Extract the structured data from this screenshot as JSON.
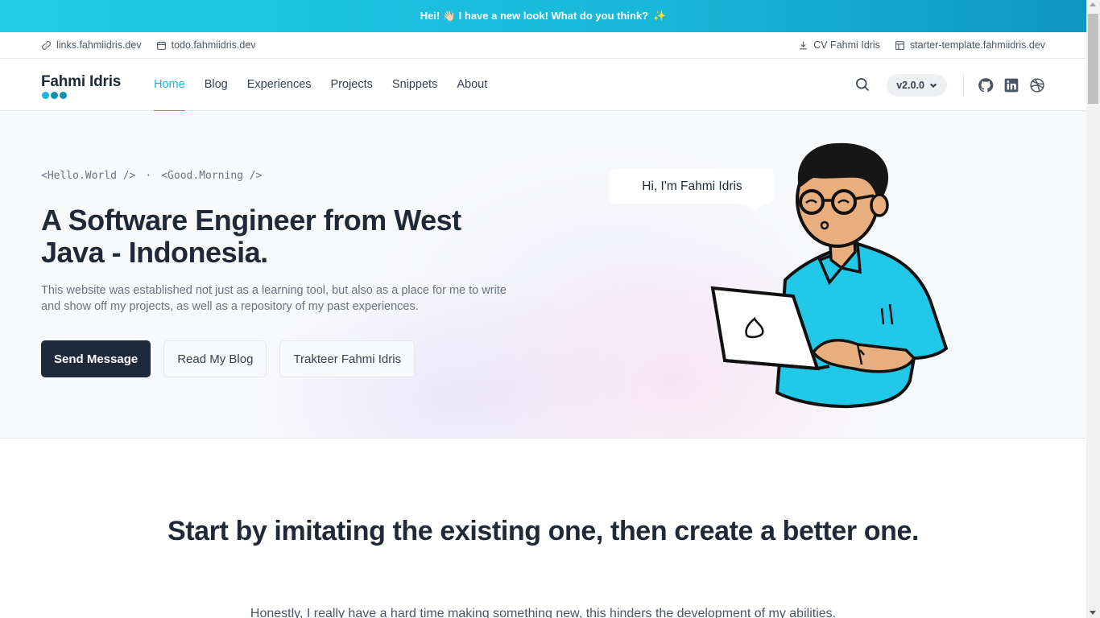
{
  "announcement": {
    "text": "Hei! 👋🏻 I have a new look! What do you think?",
    "icon": "sparkles-icon"
  },
  "topbar": {
    "left": [
      {
        "label": "links.fahmiidris.dev",
        "icon": "link-icon"
      },
      {
        "label": "todo.fahmiidris.dev",
        "icon": "calendar-icon"
      }
    ],
    "right": [
      {
        "label": "CV Fahmi Idris",
        "icon": "download-icon"
      },
      {
        "label": "starter-template.fahmiidris.dev",
        "icon": "template-icon"
      }
    ]
  },
  "nav": {
    "logo": "Fahmi Idris",
    "items": [
      {
        "label": "Home",
        "active": true
      },
      {
        "label": "Blog"
      },
      {
        "label": "Experiences"
      },
      {
        "label": "Projects"
      },
      {
        "label": "Snippets"
      },
      {
        "label": "About"
      }
    ],
    "version": "v2.0.0",
    "social": [
      "github-icon",
      "linkedin-icon",
      "dribbble-icon"
    ]
  },
  "hero": {
    "greeting_1": "<Hello.World />",
    "greeting_sep": "·",
    "greeting_2": "<Good.Morning />",
    "title": "A Software Engineer from West Java - Indonesia.",
    "description": "This website was established not just as a learning tool, but also as a place for me to write and show off my projects, as well as a repository of my past experiences.",
    "buttons": {
      "send": "Send Message",
      "blog": "Read My Blog",
      "trakteer": "Trakteer Fahmi Idris"
    },
    "bubble": "Hi, I'm Fahmi Idris"
  },
  "section": {
    "title": "Start by imitating the existing one, then create a better one.",
    "text": "Honestly, I really have a hard time making something new, this hinders the development of my abilities."
  },
  "colors": {
    "accent": "#18b8d8",
    "dark": "#1e293b",
    "shirt": "#22c8e8",
    "skin": "#e8ae7e"
  }
}
